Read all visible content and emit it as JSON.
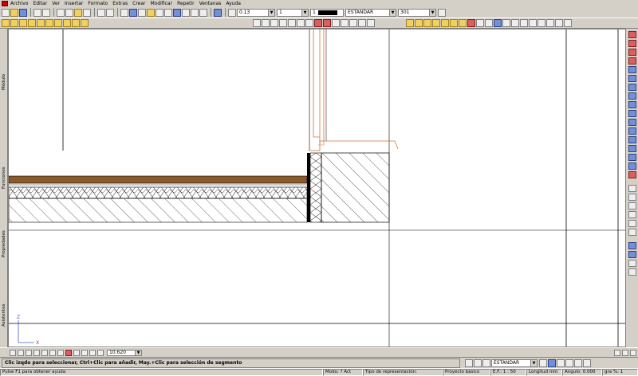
{
  "menu": {
    "items": [
      "Archivo",
      "Editar",
      "Ver",
      "Insertar",
      "Formato",
      "Extras",
      "Crear",
      "Modificar",
      "Repetir",
      "Ventanas",
      "Ayuda"
    ]
  },
  "toolbar": {
    "line_width": "0.13",
    "line_type": "1",
    "pen_number": "1",
    "layer_style": "ESTANDAR",
    "hatch_number": "301"
  },
  "left_tabs": {
    "modulo": "Módulo",
    "funciones": "Funciones",
    "propiedades": "Propiedades",
    "asistentes": "Asistentes"
  },
  "zoom": {
    "value": "10.620"
  },
  "coordinate_axes": {
    "y_label": "Z",
    "x_label": "X"
  },
  "command_line": {
    "text": "Clic izqdo para seleccionar, Ctrl+Clic para añadir, May.+Clic para selección de segmento",
    "combo_value": "ESTANDAR"
  },
  "status": {
    "help": "Pulse F1 para obtener ayuda",
    "modo_label": "Modo:",
    "modo_value": "? Act",
    "tipo_label": "Tipo de representación:",
    "tipo_value": "Proyecto básico",
    "scale_label": "E.F.:",
    "scale_value": "1 : 50",
    "longitud_label": "Longitud",
    "longitud_unit": "mm",
    "angulo_label": "Angulo:",
    "angulo_value": "0.000",
    "angulo_unit": "gra",
    "percent_label": "%:",
    "percent_value": "1"
  },
  "colors": {
    "ui_gray": "#d4d0c8",
    "wood_brown": "#8b5a2b",
    "orange_line": "#d07030",
    "canvas": "#ffffff"
  }
}
